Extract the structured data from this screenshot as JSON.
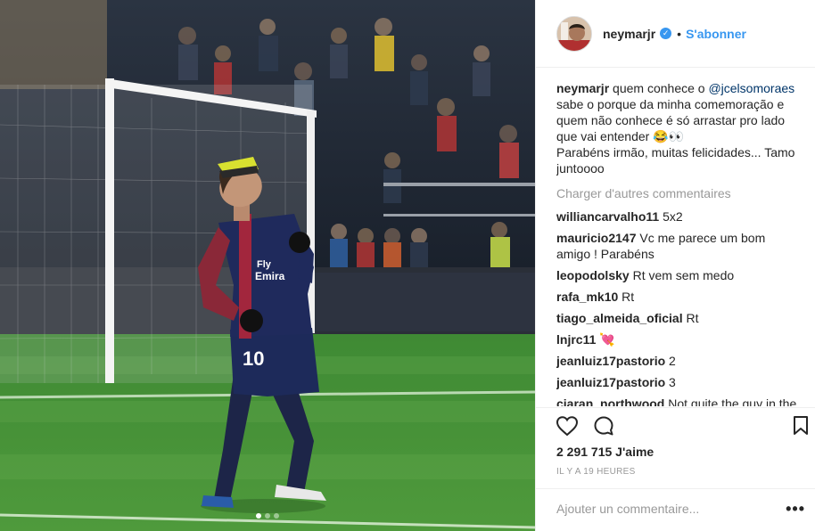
{
  "post": {
    "carousel": {
      "count": 3,
      "active": 0
    }
  },
  "header": {
    "username": "neymarjr",
    "bullet": "•",
    "follow_label": "S'abonner"
  },
  "caption": {
    "username": "neymarjr",
    "text_before": " quem conhece o ",
    "mention": "@jcelsomoraes",
    "text_after": " sabe o porque da minha comemoração e quem não conhece é só arrastar pro lado que vai entender 😂👀\nParabéns irmão, muitas felicidades... Tamo juntoooo"
  },
  "load_more_label": "Charger d'autres commentaires",
  "comments": [
    {
      "username": "williancarvalho11",
      "text": "5x2"
    },
    {
      "username": "mauricio2147",
      "text": "Vc me parece um bom amigo ! Parabéns"
    },
    {
      "username": "leopodolsky",
      "text": "Rt vem sem medo"
    },
    {
      "username": "rafa_mk10",
      "text": "Rt"
    },
    {
      "username": "tiago_almeida_oficial",
      "text": "Rt"
    },
    {
      "username": "lnjrc11",
      "text": "💘"
    },
    {
      "username": "jeanluiz17pastorio",
      "text": "2"
    },
    {
      "username": "jeanluiz17pastorio",
      "text": "3"
    },
    {
      "username": "ciaran_northwood",
      "text": "Not quite the guy in the"
    }
  ],
  "likes": "2 291 715 J'aime",
  "time": "IL Y A 19 HEURES",
  "add_comment": {
    "placeholder": "Ajouter un commentaire...",
    "more_label": "•••"
  },
  "icons": {
    "like": "heart-outline-icon",
    "comment": "speech-bubble-icon",
    "save": "bookmark-icon",
    "verified": "verified-badge-icon"
  },
  "colors": {
    "accent": "#3897f0",
    "mention": "#003569",
    "muted": "#999999",
    "text": "#262626"
  }
}
